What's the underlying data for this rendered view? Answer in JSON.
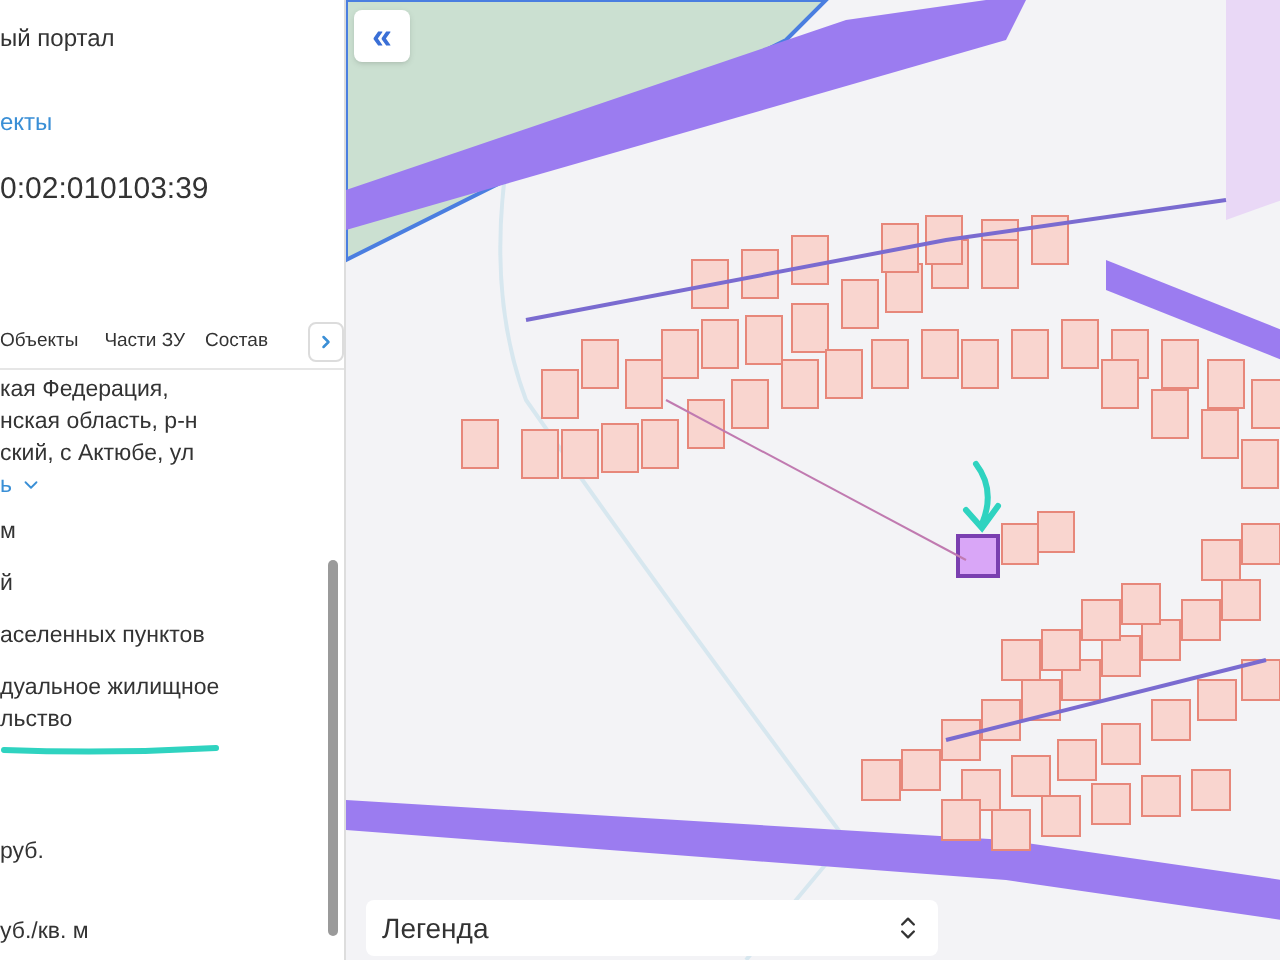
{
  "panel": {
    "portal_title": "ый портал",
    "breadcrumb_link": "екты",
    "cadastral_number": "0:02:010103:39",
    "tabs": [
      {
        "label": "Объекты"
      },
      {
        "label": "Части ЗУ"
      },
      {
        "label": "Состав"
      }
    ],
    "address_lines": [
      "кая Федерация,",
      "нская область, р-н",
      "ский, с Актюбе, ул"
    ],
    "expand_link": "ь",
    "fields": [
      {
        "lines": [
          "м"
        ],
        "highlighted": false
      },
      {
        "lines": [
          "й"
        ],
        "highlighted": false
      },
      {
        "lines": [
          "аселенных пунктов"
        ],
        "highlighted": false
      },
      {
        "lines": [
          "дуальное жилищное",
          "льство"
        ],
        "highlighted": true
      },
      {
        "lines": [
          "руб."
        ],
        "highlighted": false
      },
      {
        "lines": [
          "уб./кв. м"
        ],
        "highlighted": false
      }
    ]
  },
  "map": {
    "collapse_button": "«",
    "legend": {
      "label": "Легенда"
    }
  }
}
